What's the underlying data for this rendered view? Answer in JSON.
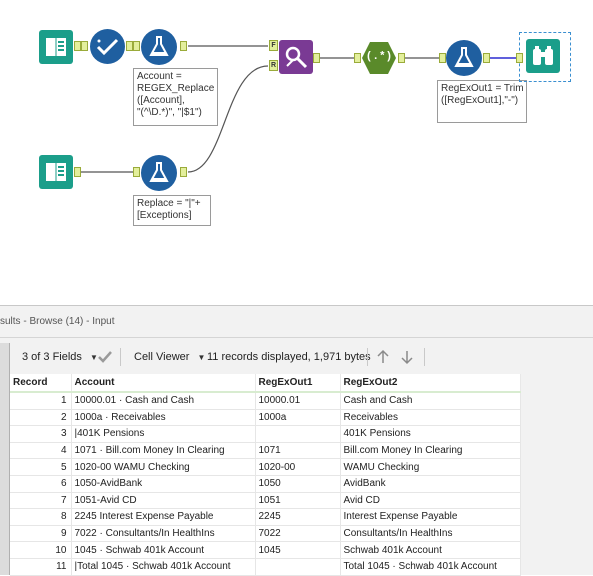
{
  "workflow": {
    "annotations": {
      "regex_replace_account": [
        "Account =",
        "REGEX_Replace",
        "([Account],",
        "\"(^\\D.*)\", \"|$1\")"
      ],
      "replace_exceptions": [
        "Replace = \"|\"+",
        "[Exceptions]"
      ],
      "trim_regexout1": [
        "RegExOut1 = Trim",
        "([RegExOut1],\"-\")"
      ]
    },
    "anchor_labels": {
      "find": "F",
      "replace": "R"
    },
    "regex_tool_label": "(.*)"
  },
  "results": {
    "title": "sults - Browse (14) - Input",
    "toolbar": {
      "fields_label": "3 of 3 Fields",
      "viewer_label": "Cell Viewer",
      "records_info": "11 records displayed, 1,971 bytes"
    },
    "columns": [
      "Record",
      "Account",
      "RegExOut1",
      "RegExOut2"
    ],
    "rows": [
      {
        "record": "1",
        "account": "10000.01 · Cash and Cash",
        "regexout1": "10000.01",
        "regexout2": "Cash and Cash"
      },
      {
        "record": "2",
        "account": "1000a · Receivables",
        "regexout1": "1000a",
        "regexout2": "Receivables"
      },
      {
        "record": "3",
        "account": "|401K Pensions",
        "regexout1": "",
        "regexout2": "401K Pensions"
      },
      {
        "record": "4",
        "account": "1071 · Bill.com Money In Clearing",
        "regexout1": "1071",
        "regexout2": "Bill.com Money In Clearing"
      },
      {
        "record": "5",
        "account": "1020-00 WAMU Checking",
        "regexout1": "1020-00",
        "regexout2": "WAMU Checking"
      },
      {
        "record": "6",
        "account": "1050-AvidBank",
        "regexout1": "1050",
        "regexout2": "AvidBank"
      },
      {
        "record": "7",
        "account": "1051-Avid CD",
        "regexout1": "1051",
        "regexout2": "Avid CD"
      },
      {
        "record": "8",
        "account": "2245 Interest Expense Payable",
        "regexout1": "2245",
        "regexout2": "Interest Expense Payable"
      },
      {
        "record": "9",
        "account": "7022 · Consultants/In HealthIns",
        "regexout1": "7022",
        "regexout2": "Consultants/In HealthIns"
      },
      {
        "record": "10",
        "account": "1045 · Schwab 401k Account",
        "regexout1": "1045",
        "regexout2": "Schwab 401k Account"
      },
      {
        "record": "11",
        "account": "|Total 1045 · Schwab 401k Account",
        "regexout1": "",
        "regexout2": "Total 1045 · Schwab 401k Account"
      }
    ]
  },
  "colors": {
    "input_tool": "#1b9e8a",
    "select_tool": "#1f5fa0",
    "formula_tool": "#1f5fa0",
    "find_replace_tool": "#7a3a94",
    "regex_tool": "#5a8a2a",
    "browse_tool": "#1b9e8a",
    "anchor_fill": "#e3ef9c"
  },
  "icons": [
    "book-icon",
    "checkmark-icon",
    "flask-icon",
    "wand-icon",
    "regex-icon",
    "binoculars-icon",
    "chevron-down-icon",
    "up-arrow-icon",
    "down-arrow-icon"
  ]
}
